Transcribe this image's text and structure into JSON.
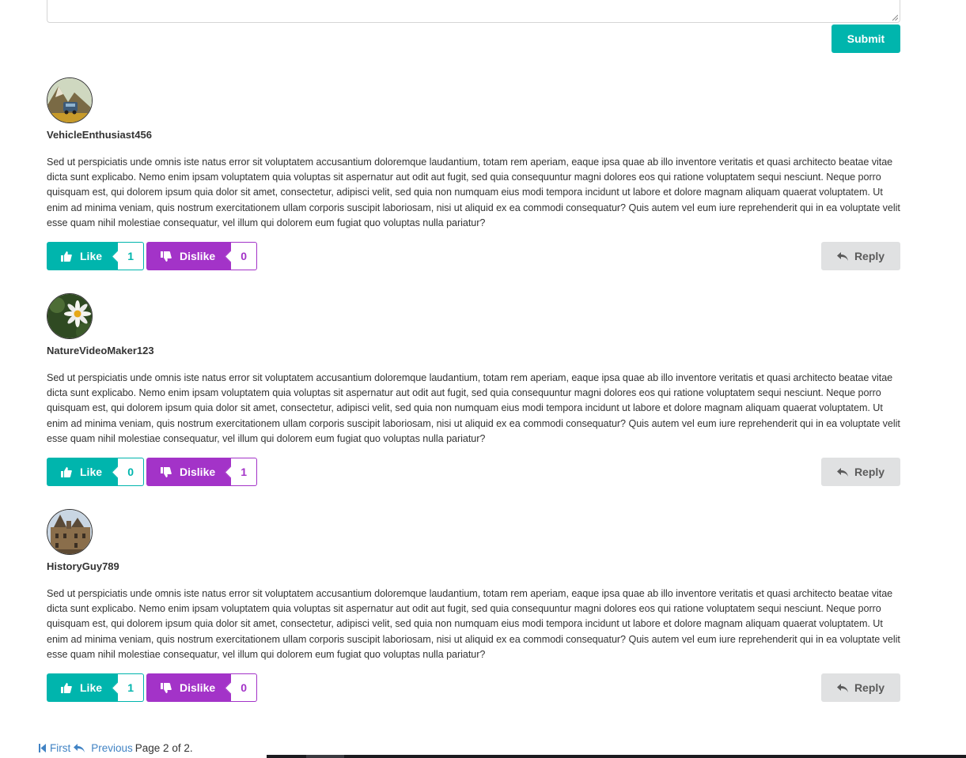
{
  "form": {
    "submit_label": "Submit"
  },
  "comments": [
    {
      "author": "VehicleEnthusiast456",
      "avatar_icon": "car-landscape-avatar",
      "text": "Sed ut perspiciatis unde omnis iste natus error sit voluptatem accusantium doloremque laudantium, totam rem aperiam, eaque ipsa quae ab illo inventore veritatis et quasi architecto beatae vitae dicta sunt explicabo. Nemo enim ipsam voluptatem quia voluptas sit aspernatur aut odit aut fugit, sed quia consequuntur magni dolores eos qui ratione voluptatem sequi nesciunt. Neque porro quisquam est, qui dolorem ipsum quia dolor sit amet, consectetur, adipisci velit, sed quia non numquam eius modi tempora incidunt ut labore et dolore magnam aliquam quaerat voluptatem. Ut enim ad minima veniam, quis nostrum exercitationem ullam corporis suscipit laboriosam, nisi ut aliquid ex ea commodi consequatur? Quis autem vel eum iure reprehenderit qui in ea voluptate velit esse quam nihil molestiae consequatur, vel illum qui dolorem eum fugiat quo voluptas nulla pariatur?",
      "like_label": "Like",
      "like_count": "1",
      "dislike_label": "Dislike",
      "dislike_count": "0",
      "reply_label": "Reply"
    },
    {
      "author": "NatureVideoMaker123",
      "avatar_icon": "daisy-flower-avatar",
      "text": "Sed ut perspiciatis unde omnis iste natus error sit voluptatem accusantium doloremque laudantium, totam rem aperiam, eaque ipsa quae ab illo inventore veritatis et quasi architecto beatae vitae dicta sunt explicabo. Nemo enim ipsam voluptatem quia voluptas sit aspernatur aut odit aut fugit, sed quia consequuntur magni dolores eos qui ratione voluptatem sequi nesciunt. Neque porro quisquam est, qui dolorem ipsum quia dolor sit amet, consectetur, adipisci velit, sed quia non numquam eius modi tempora incidunt ut labore et dolore magnam aliquam quaerat voluptatem. Ut enim ad minima veniam, quis nostrum exercitationem ullam corporis suscipit laboriosam, nisi ut aliquid ex ea commodi consequatur? Quis autem vel eum iure reprehenderit qui in ea voluptate velit esse quam nihil molestiae consequatur, vel illum qui dolorem eum fugiat quo voluptas nulla pariatur?",
      "like_label": "Like",
      "like_count": "0",
      "dislike_label": "Dislike",
      "dislike_count": "1",
      "reply_label": "Reply"
    },
    {
      "author": "HistoryGuy789",
      "avatar_icon": "castle-avatar",
      "text": "Sed ut perspiciatis unde omnis iste natus error sit voluptatem accusantium doloremque laudantium, totam rem aperiam, eaque ipsa quae ab illo inventore veritatis et quasi architecto beatae vitae dicta sunt explicabo. Nemo enim ipsam voluptatem quia voluptas sit aspernatur aut odit aut fugit, sed quia consequuntur magni dolores eos qui ratione voluptatem sequi nesciunt. Neque porro quisquam est, qui dolorem ipsum quia dolor sit amet, consectetur, adipisci velit, sed quia non numquam eius modi tempora incidunt ut labore et dolore magnam aliquam quaerat voluptatem. Ut enim ad minima veniam, quis nostrum exercitationem ullam corporis suscipit laboriosam, nisi ut aliquid ex ea commodi consequatur? Quis autem vel eum iure reprehenderit qui in ea voluptate velit esse quam nihil molestiae consequatur, vel illum qui dolorem eum fugiat quo voluptas nulla pariatur?",
      "like_label": "Like",
      "like_count": "1",
      "dislike_label": "Dislike",
      "dislike_count": "0",
      "reply_label": "Reply"
    }
  ],
  "pagination": {
    "first_label": "First",
    "previous_label": "Previous",
    "page_text": "Page 2 of 2."
  },
  "colors": {
    "like": "#00b5ad",
    "dislike": "#a333c8",
    "reply_bg": "#e0e1e2",
    "link": "#4183c4"
  }
}
